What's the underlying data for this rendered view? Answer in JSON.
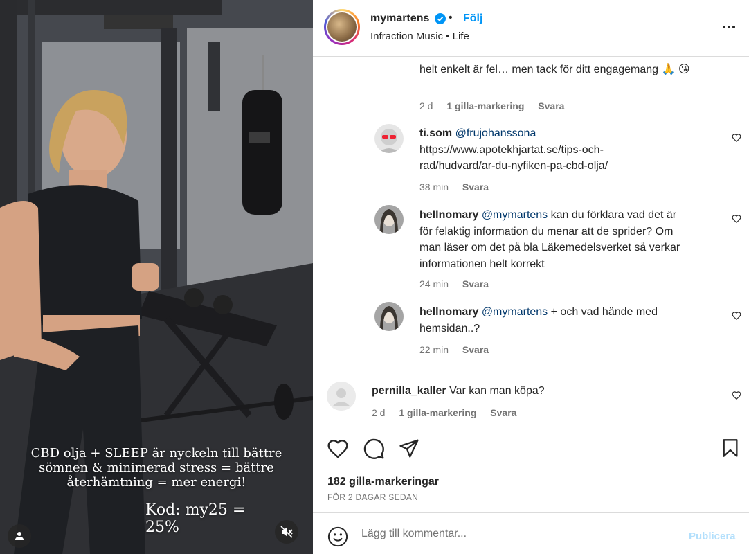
{
  "media": {
    "overlay_caption": "CBD olja + SLEEP är nyckeln till bättre sömnen & minimerad stress = bättre återhämtning = mer energi!",
    "overlay_code": "Kod: my25 = 25%",
    "icons": [
      "user-tag-icon",
      "audio-muted-icon"
    ]
  },
  "header": {
    "username": "mymartens",
    "verified": true,
    "separator": "•",
    "follow_label": "Följ",
    "subtitle": "Infraction Music • Life",
    "more_icon": "more-horizontal-icon"
  },
  "comments": [
    {
      "text": "helt enkelt är fel… men tack för ditt engagemang 🙏 😘",
      "time": "2 d",
      "likes": "1 gilla-markering",
      "reply": "Svara"
    },
    {
      "username": "ti.som",
      "mention": "@frujohanssona",
      "text_line1": "https://www.apotekhjartat.se/tips-och-",
      "text_line2": "rad/hudvard/ar-du-nyfiken-pa-cbd-olja/",
      "time": "38 min",
      "reply": "Svara"
    },
    {
      "username": "hellnomary",
      "mention": "@mymartens",
      "text_line1": "kan du förklara vad det är",
      "text_line2": "för felaktig information du menar att de sprider? Om",
      "text_line3": "man läser om det på bla Läkemedelsverket så verkar",
      "text_line4": "informationen helt korrekt",
      "time": "24 min",
      "reply": "Svara"
    },
    {
      "username": "hellnomary",
      "mention": "@mymartens",
      "text_line1": "+ och vad hände med",
      "text_line2": "hemsidan..?",
      "time": "22 min",
      "reply": "Svara"
    },
    {
      "username": "pernilla_kaller",
      "text": "Var kan man köpa?",
      "time": "2 d",
      "likes": "1 gilla-markering",
      "reply": "Svara"
    }
  ],
  "actions": {
    "icons": [
      "like-heart-icon",
      "comment-icon",
      "share-icon",
      "save-bookmark-icon"
    ],
    "likes_count": "182 gilla-markeringar",
    "posted": "FÖR 2 DAGAR SEDAN"
  },
  "add_comment": {
    "placeholder": "Lägg till kommentar...",
    "post_label": "Publicera"
  },
  "colors": {
    "accent": "#0095f6",
    "mention": "#00376b",
    "muted_text": "#737373",
    "post_disabled": "#b2dffc",
    "border": "#dbdbdb"
  }
}
